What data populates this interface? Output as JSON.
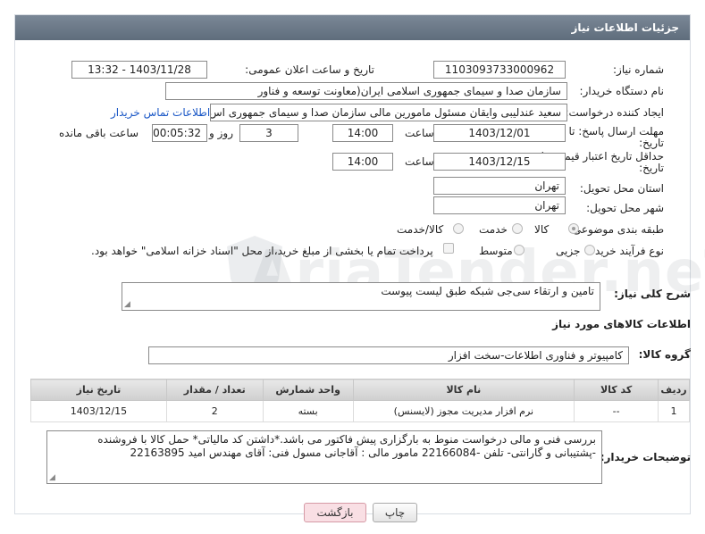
{
  "header": {
    "title": "جزئیات اطلاعات نیاز"
  },
  "fields": {
    "need_number": {
      "label": "شماره نیاز:",
      "value": "1103093733000962"
    },
    "announce": {
      "label": "تاریخ و ساعت اعلان عمومی:",
      "value": "1403/11/28 - 13:32"
    },
    "buyer_org": {
      "label": "نام دستگاه خریدار:",
      "value": "سازمان صدا و سیمای جمهوری اسلامی ایران(معاونت توسعه و فناور"
    },
    "requester": {
      "label": "ایجاد کننده درخواست:",
      "value": "سعید عندلیبی وایقان مسئول مامورین مالی  سازمان صدا و سیمای جمهوری اس",
      "contact_link": "اطلاعات تماس خریدار"
    },
    "deadline": {
      "label_line1": "مهلت ارسال پاسخ: تا",
      "label_line2": "تاریخ:",
      "date": "1403/12/01",
      "time_label": "ساعت",
      "time": "14:00",
      "days": "3",
      "days_label": "روز و",
      "remaining": "00:05:32",
      "remaining_label": "ساعت باقی مانده"
    },
    "price_validity": {
      "label_line1": "حداقل تاریخ اعتبار قیمت: تا",
      "label_line2": "تاریخ:",
      "date": "1403/12/15",
      "time_label": "ساعت",
      "time": "14:00"
    },
    "province": {
      "label": "استان محل تحویل:",
      "value": "تهران"
    },
    "city": {
      "label": "شهر محل تحویل:",
      "value": "تهران"
    },
    "category": {
      "label": "طبقه بندی موضوعی:",
      "options": [
        "کالا",
        "خدمت",
        "کالا/خدمت"
      ],
      "selected": "کالا"
    },
    "process": {
      "label": "نوع فرآیند خرید :",
      "options": [
        "جزیی",
        "متوسط"
      ],
      "payment_note": "پرداخت تمام یا بخشی از مبلغ خرید،از محل \"اسناد خزانه اسلامی\" خواهد بود."
    }
  },
  "summary": {
    "label": "شرح کلی نیاز:",
    "value": "تامین و ارتقاء سی‌جی شبکه طبق لیست پیوست"
  },
  "goods_section": {
    "title": "اطلاعات کالاهای مورد نیاز",
    "group_label": "گروه کالا:",
    "group_value": "کامپیوتر و فناوری اطلاعات-سخت افزار"
  },
  "table": {
    "headers": [
      "ردیف",
      "کد کالا",
      "نام کالا",
      "واحد شمارش",
      "تعداد / مقدار",
      "تاریخ نیاز"
    ],
    "rows": [
      [
        "1",
        "--",
        "نرم افزار مدیریت مجوز (لایسنس)",
        "بسته",
        "2",
        "1403/12/15"
      ]
    ]
  },
  "buyer_notes": {
    "label": "توضیحات خریدار:",
    "line1": "بررسی فنی و مالی درخواست منوط به بارگزاری پیش فاکتور می باشد.*داشتن کد مالیاتی*  حمل کالا با فروشنده",
    "line2": "-پشتیبانی و گارانتی- تلفن -22166084 مامور مالی : آقاجانی مسول فنی: آقای مهندس امید 22163895"
  },
  "buttons": {
    "print": "چاپ",
    "back": "بازگشت"
  },
  "watermark": "AriaTender.neT",
  "colors": {
    "header": "#6b7887",
    "link": "#1a57c6",
    "back_button": "#f9dfe4"
  }
}
